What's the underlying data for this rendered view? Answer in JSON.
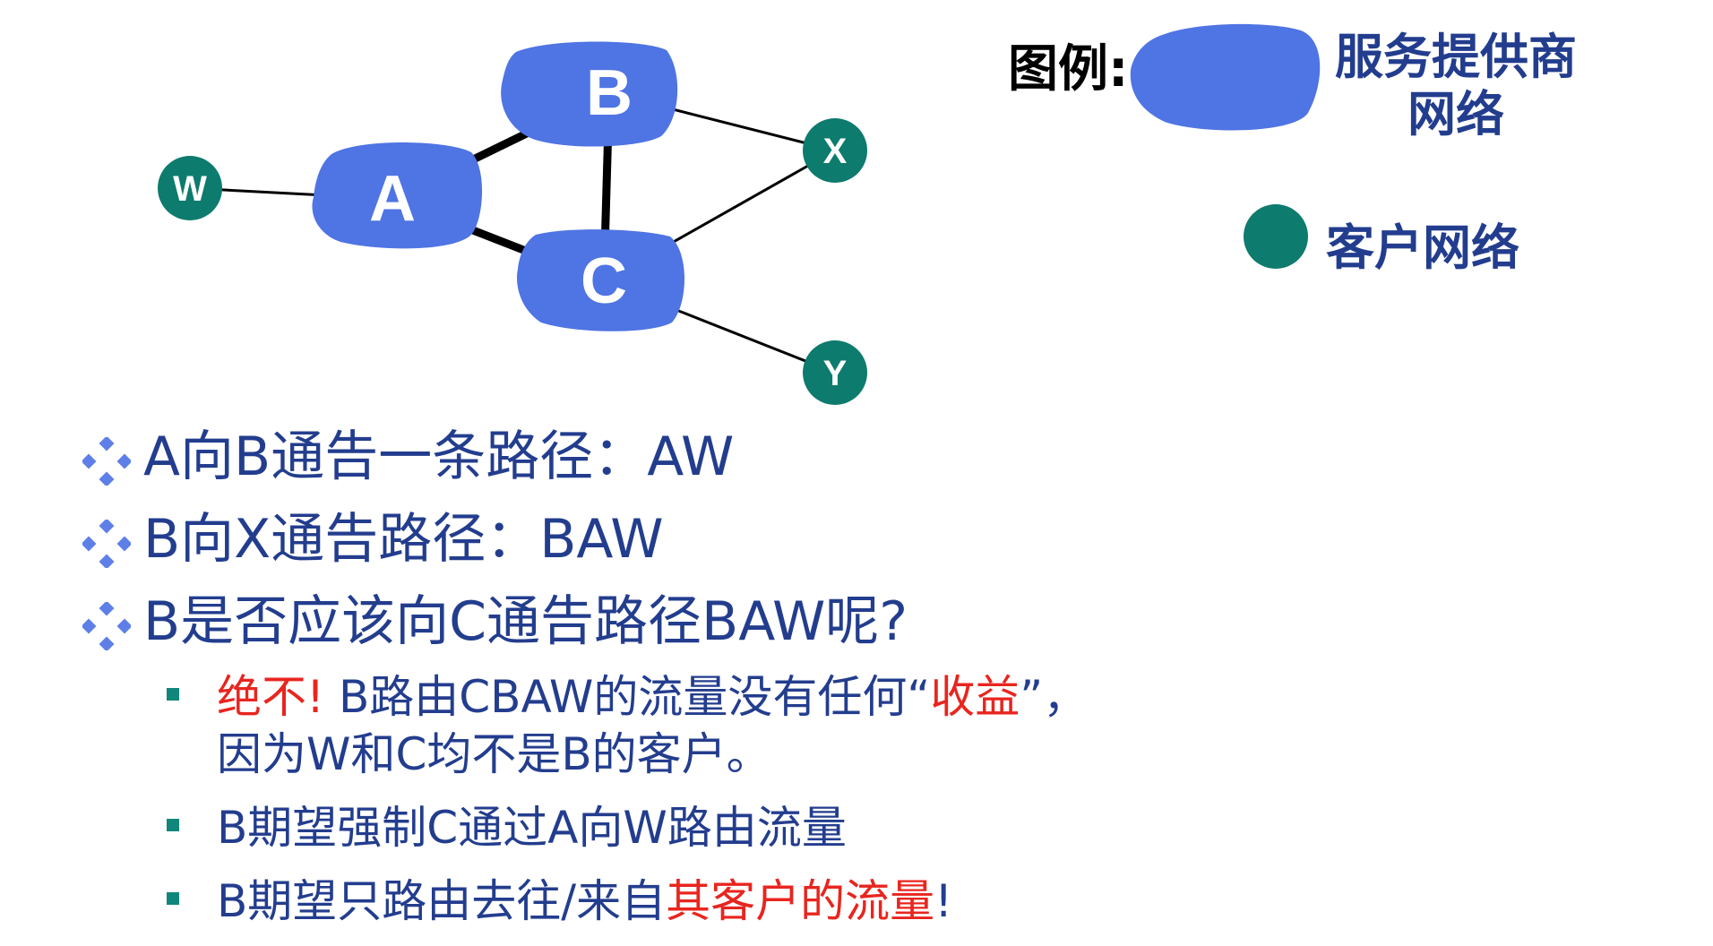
{
  "diagram": {
    "providers": [
      {
        "id": "A",
        "label": "A"
      },
      {
        "id": "B",
        "label": "B"
      },
      {
        "id": "C",
        "label": "C"
      }
    ],
    "customers": [
      {
        "id": "W",
        "label": "W"
      },
      {
        "id": "X",
        "label": "X"
      },
      {
        "id": "Y",
        "label": "Y"
      }
    ],
    "links": [
      {
        "from": "W",
        "to": "A",
        "weight": "thin"
      },
      {
        "from": "A",
        "to": "B",
        "weight": "thick"
      },
      {
        "from": "A",
        "to": "C",
        "weight": "thick"
      },
      {
        "from": "B",
        "to": "C",
        "weight": "thick"
      },
      {
        "from": "B",
        "to": "X",
        "weight": "thin"
      },
      {
        "from": "C",
        "to": "X",
        "weight": "thin"
      },
      {
        "from": "C",
        "to": "Y",
        "weight": "thin"
      }
    ]
  },
  "legend": {
    "title": "图例:",
    "provider_label": "服务提供商网络",
    "customer_label": "客户网络"
  },
  "bullets": [
    "A向B通告一条路径：AW",
    "B向X通告路径：BAW",
    "B是否应该向C通告路径BAW呢?"
  ],
  "sub_bullets": [
    {
      "lines": [
        {
          "parts": [
            {
              "text": "绝不! ",
              "color": "red"
            },
            {
              "text": "B路由CBAW的流量没有任何“",
              "color": "blue"
            },
            {
              "text": "收益",
              "color": "red"
            },
            {
              "text": "”，",
              "color": "blue"
            }
          ]
        },
        {
          "parts": [
            {
              "text": "因为W和C均不是B的客户。",
              "color": "blue"
            }
          ]
        }
      ]
    },
    {
      "lines": [
        {
          "parts": [
            {
              "text": "B期望强制C通过A向W路由流量",
              "color": "blue"
            }
          ]
        }
      ]
    },
    {
      "lines": [
        {
          "parts": [
            {
              "text": "B期望只路由去往/来自",
              "color": "blue"
            },
            {
              "text": "其客户的流量",
              "color": "red"
            },
            {
              "text": "!",
              "color": "blue"
            }
          ]
        }
      ]
    }
  ],
  "colors": {
    "provider": "#4f74e3",
    "customer": "#0d7b6d",
    "text_blue": "#233d8e",
    "text_red": "#e8251f",
    "bullet_diamond": "#5f7fe8",
    "bullet_square": "#10877a"
  }
}
